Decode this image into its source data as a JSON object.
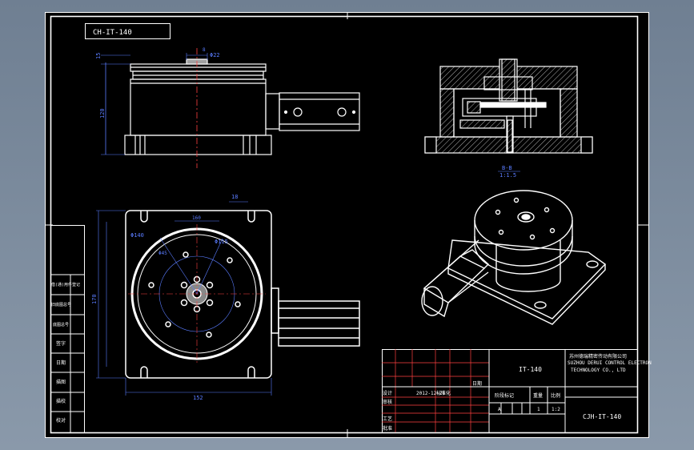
{
  "drawing": {
    "code_box_top_left": "CH-IT-140",
    "title_block": {
      "company_cn": "苏州德瑞精密传动有限公司",
      "company_en_line1": "SUZHOU DERUI CONTROL ELECTRON",
      "company_en_line2": "TECHNOLOGY CO., LTD",
      "part_name": "IT-140",
      "drawing_no": "CJH-IT-140",
      "date": "2012-12-21",
      "scale": "1:2",
      "stage": "A",
      "quantity": "1",
      "label_stage": "阶段标记",
      "label_weight": "重量",
      "label_scale": "比例",
      "label_designer": "设计",
      "label_check": "审核",
      "label_approve": "批准",
      "label_standard": "标准化",
      "label_process": "工艺",
      "label_date": "日期"
    },
    "left_block_labels": [
      "借(通)用件登记",
      "旧底图总号",
      "底图总号",
      "签字",
      "日期",
      "描图",
      "描校",
      "校对"
    ],
    "dimensions": {
      "side_top": "15",
      "side_dia": "Φ22",
      "side_height": "120",
      "side_small": "8",
      "plan_top": "18",
      "plan_dia_big": "Φ140",
      "plan_dia_inner": "Φ115",
      "plan_pcd": "Φ45",
      "plan_height": "170",
      "plan_width_inner": "160",
      "plan_width": "152"
    },
    "section_label": "B-B",
    "section_scale": "1:1.5"
  }
}
